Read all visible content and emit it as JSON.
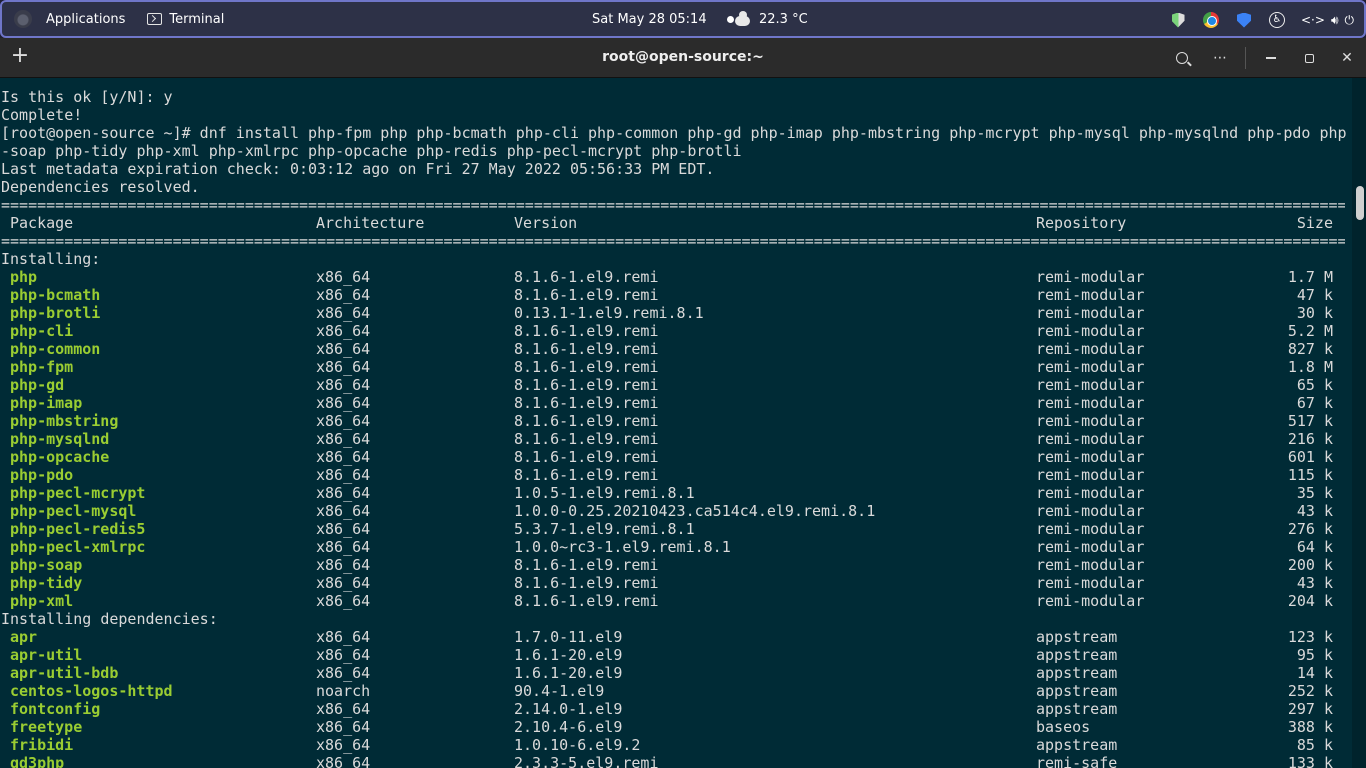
{
  "top_panel": {
    "applications": "Applications",
    "terminal": "Terminal",
    "date_time": "Sat May 28  05:14",
    "weather": "22.3 °C"
  },
  "window": {
    "title": "root@open-source:~",
    "new_tab": "+",
    "more": "⋯",
    "close": "✕"
  },
  "terminal": {
    "lines_before": [
      "Is this ok [y/N]: y",
      "Complete!",
      "[root@open-source ~]# dnf install php-fpm php php-bcmath php-cli php-common php-gd php-imap php-mbstring php-mcrypt php-mysql php-mysqlnd php-pdo php",
      "-soap php-tidy php-xml php-xmlrpc php-opcache php-redis php-pecl-mcrypt php-brotli",
      "Last metadata expiration check: 0:03:12 ago on Fri 27 May 2022 05:56:33 PM EDT.",
      "Dependencies resolved."
    ],
    "separator": "========================================================================================================================================================================",
    "headers": {
      "package": "Package",
      "arch": "Architecture",
      "version": "Version",
      "repo": "Repository",
      "size": "Size"
    },
    "installing_label": "Installing:",
    "installing": [
      {
        "name": "php",
        "arch": "x86_64",
        "version": "8.1.6-1.el9.remi",
        "repo": "remi-modular",
        "size": "1.7 M"
      },
      {
        "name": "php-bcmath",
        "arch": "x86_64",
        "version": "8.1.6-1.el9.remi",
        "repo": "remi-modular",
        "size": "47 k"
      },
      {
        "name": "php-brotli",
        "arch": "x86_64",
        "version": "0.13.1-1.el9.remi.8.1",
        "repo": "remi-modular",
        "size": "30 k"
      },
      {
        "name": "php-cli",
        "arch": "x86_64",
        "version": "8.1.6-1.el9.remi",
        "repo": "remi-modular",
        "size": "5.2 M"
      },
      {
        "name": "php-common",
        "arch": "x86_64",
        "version": "8.1.6-1.el9.remi",
        "repo": "remi-modular",
        "size": "827 k"
      },
      {
        "name": "php-fpm",
        "arch": "x86_64",
        "version": "8.1.6-1.el9.remi",
        "repo": "remi-modular",
        "size": "1.8 M"
      },
      {
        "name": "php-gd",
        "arch": "x86_64",
        "version": "8.1.6-1.el9.remi",
        "repo": "remi-modular",
        "size": "65 k"
      },
      {
        "name": "php-imap",
        "arch": "x86_64",
        "version": "8.1.6-1.el9.remi",
        "repo": "remi-modular",
        "size": "67 k"
      },
      {
        "name": "php-mbstring",
        "arch": "x86_64",
        "version": "8.1.6-1.el9.remi",
        "repo": "remi-modular",
        "size": "517 k"
      },
      {
        "name": "php-mysqlnd",
        "arch": "x86_64",
        "version": "8.1.6-1.el9.remi",
        "repo": "remi-modular",
        "size": "216 k"
      },
      {
        "name": "php-opcache",
        "arch": "x86_64",
        "version": "8.1.6-1.el9.remi",
        "repo": "remi-modular",
        "size": "601 k"
      },
      {
        "name": "php-pdo",
        "arch": "x86_64",
        "version": "8.1.6-1.el9.remi",
        "repo": "remi-modular",
        "size": "115 k"
      },
      {
        "name": "php-pecl-mcrypt",
        "arch": "x86_64",
        "version": "1.0.5-1.el9.remi.8.1",
        "repo": "remi-modular",
        "size": "35 k"
      },
      {
        "name": "php-pecl-mysql",
        "arch": "x86_64",
        "version": "1.0.0-0.25.20210423.ca514c4.el9.remi.8.1",
        "repo": "remi-modular",
        "size": "43 k"
      },
      {
        "name": "php-pecl-redis5",
        "arch": "x86_64",
        "version": "5.3.7-1.el9.remi.8.1",
        "repo": "remi-modular",
        "size": "276 k"
      },
      {
        "name": "php-pecl-xmlrpc",
        "arch": "x86_64",
        "version": "1.0.0~rc3-1.el9.remi.8.1",
        "repo": "remi-modular",
        "size": "64 k"
      },
      {
        "name": "php-soap",
        "arch": "x86_64",
        "version": "8.1.6-1.el9.remi",
        "repo": "remi-modular",
        "size": "200 k"
      },
      {
        "name": "php-tidy",
        "arch": "x86_64",
        "version": "8.1.6-1.el9.remi",
        "repo": "remi-modular",
        "size": "43 k"
      },
      {
        "name": "php-xml",
        "arch": "x86_64",
        "version": "8.1.6-1.el9.remi",
        "repo": "remi-modular",
        "size": "204 k"
      }
    ],
    "deps_label": "Installing dependencies:",
    "dependencies": [
      {
        "name": "apr",
        "arch": "x86_64",
        "version": "1.7.0-11.el9",
        "repo": "appstream",
        "size": "123 k"
      },
      {
        "name": "apr-util",
        "arch": "x86_64",
        "version": "1.6.1-20.el9",
        "repo": "appstream",
        "size": "95 k"
      },
      {
        "name": "apr-util-bdb",
        "arch": "x86_64",
        "version": "1.6.1-20.el9",
        "repo": "appstream",
        "size": "14 k"
      },
      {
        "name": "centos-logos-httpd",
        "arch": "noarch",
        "version": "90.4-1.el9",
        "repo": "appstream",
        "size": "252 k"
      },
      {
        "name": "fontconfig",
        "arch": "x86_64",
        "version": "2.14.0-1.el9",
        "repo": "appstream",
        "size": "297 k"
      },
      {
        "name": "freetype",
        "arch": "x86_64",
        "version": "2.10.4-6.el9",
        "repo": "baseos",
        "size": "388 k"
      },
      {
        "name": "fribidi",
        "arch": "x86_64",
        "version": "1.0.10-6.el9.2",
        "repo": "appstream",
        "size": "85 k"
      },
      {
        "name": "gd3php",
        "arch": "x86_64",
        "version": "2.3.3-5.el9.remi",
        "repo": "remi-safe",
        "size": "133 k"
      }
    ]
  }
}
